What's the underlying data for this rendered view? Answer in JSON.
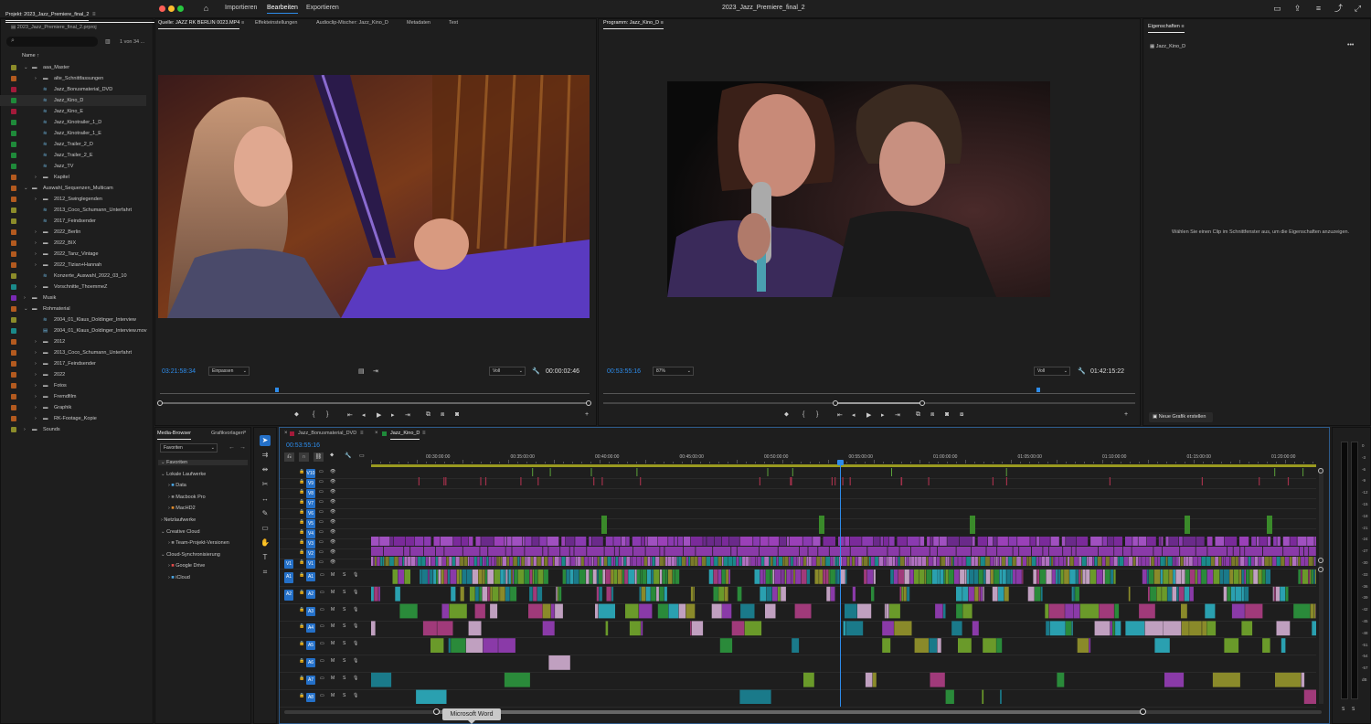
{
  "app": {
    "title": "2023_Jazz_Premiere_final_2",
    "nav": {
      "home": "home-icon",
      "import": "Importieren",
      "edit": "Bearbeiten",
      "export": "Exportieren"
    }
  },
  "project": {
    "tab": "Projekt: 2023_Jazz_Premiere_final_2",
    "file": "2023_Jazz_Premiere_final_2.prproj",
    "count": "1 von 34 ...",
    "column_name": "Name",
    "items": [
      {
        "label": "aaa_Master",
        "color": "#8c8c2a",
        "indent": 0,
        "type": "folder",
        "open": true
      },
      {
        "label": "alte_Schnittfassungen",
        "color": "#b35a1f",
        "indent": 1,
        "type": "folder"
      },
      {
        "label": "Jazz_Bonusmaterial_DVD",
        "color": "#a31a3a",
        "indent": 1,
        "type": "seq"
      },
      {
        "label": "Jazz_Kino_D",
        "color": "#1f8a3a",
        "indent": 1,
        "type": "seq",
        "selected": true
      },
      {
        "label": "Jazz_Kino_E",
        "color": "#a31a3a",
        "indent": 1,
        "type": "seq"
      },
      {
        "label": "Jazz_Kinotrailer_1_D",
        "color": "#1f8a3a",
        "indent": 1,
        "type": "seq"
      },
      {
        "label": "Jazz_Kinotrailer_1_E",
        "color": "#1f8a3a",
        "indent": 1,
        "type": "seq"
      },
      {
        "label": "Jazz_Trailer_2_D",
        "color": "#1f8a3a",
        "indent": 1,
        "type": "seq"
      },
      {
        "label": "Jazz_Trailer_2_E",
        "color": "#1f8a3a",
        "indent": 1,
        "type": "seq"
      },
      {
        "label": "Jazz_TV",
        "color": "#1f8a3a",
        "indent": 1,
        "type": "seq"
      },
      {
        "label": "Kapitel",
        "color": "#b35a1f",
        "indent": 1,
        "type": "folder"
      },
      {
        "label": "Auswahl_Sequenzen_Multicam",
        "color": "#b35a1f",
        "indent": 0,
        "type": "folder",
        "open": true
      },
      {
        "label": "2012_Swinglegenden",
        "color": "#b35a1f",
        "indent": 1,
        "type": "folder"
      },
      {
        "label": "2013_Coco_Schumann_Unterfahrt",
        "color": "#8c8c2a",
        "indent": 1,
        "type": "seq"
      },
      {
        "label": "2017_Feindsender",
        "color": "#8c8c2a",
        "indent": 1,
        "type": "seq"
      },
      {
        "label": "2022_Berlin",
        "color": "#b35a1f",
        "indent": 1,
        "type": "folder"
      },
      {
        "label": "2022_BIX",
        "color": "#b35a1f",
        "indent": 1,
        "type": "folder"
      },
      {
        "label": "2022_Tanz_Vintage",
        "color": "#b35a1f",
        "indent": 1,
        "type": "folder"
      },
      {
        "label": "2022_Tizian+Hannah",
        "color": "#b35a1f",
        "indent": 1,
        "type": "folder"
      },
      {
        "label": "Konzerte_Auswahl_2022_03_10",
        "color": "#8c8c2a",
        "indent": 1,
        "type": "seq"
      },
      {
        "label": "Vorschnitte_ThoemmeZ",
        "color": "#1a8a8a",
        "indent": 1,
        "type": "folder"
      },
      {
        "label": "Musik",
        "color": "#7a2ab3",
        "indent": 0,
        "type": "folder"
      },
      {
        "label": "Rohmaterial",
        "color": "#b35a1f",
        "indent": 0,
        "type": "folder",
        "open": true
      },
      {
        "label": "2004_01_Klaus_Doldinger_Interview",
        "color": "#8c8c2a",
        "indent": 1,
        "type": "seq"
      },
      {
        "label": "2004_01_Klaus_Doldinger_Interview.mov",
        "color": "#1a8a8a",
        "indent": 1,
        "type": "clip"
      },
      {
        "label": "2012",
        "color": "#b35a1f",
        "indent": 1,
        "type": "folder"
      },
      {
        "label": "2013_Coco_Schumann_Unterfahrt",
        "color": "#b35a1f",
        "indent": 1,
        "type": "folder"
      },
      {
        "label": "2017_Feindsender",
        "color": "#b35a1f",
        "indent": 1,
        "type": "folder"
      },
      {
        "label": "2022",
        "color": "#b35a1f",
        "indent": 1,
        "type": "folder"
      },
      {
        "label": "Fotos",
        "color": "#b35a1f",
        "indent": 1,
        "type": "folder"
      },
      {
        "label": "Fremdfilm",
        "color": "#b35a1f",
        "indent": 1,
        "type": "folder"
      },
      {
        "label": "Graphik",
        "color": "#b35a1f",
        "indent": 1,
        "type": "folder"
      },
      {
        "label": "RK-Footage_Kopie",
        "color": "#b35a1f",
        "indent": 1,
        "type": "folder"
      },
      {
        "label": "Sounds",
        "color": "#8c8c2a",
        "indent": 0,
        "type": "folder"
      }
    ]
  },
  "source": {
    "tabs": [
      "Quelle: JAZZ RK BERLIN 0023.MP4",
      "Effekteinstellungen",
      "Audioclip-Mischer: Jazz_Kino_D",
      "Metadaten",
      "Text"
    ],
    "timecode": "03:21:58:34",
    "fit": "Einpassen",
    "quality": "Voll",
    "duration": "00:00:02:46"
  },
  "program": {
    "tab": "Programm: Jazz_Kino_D",
    "timecode": "00:53:55:16",
    "zoom": "87%",
    "quality": "Voll",
    "duration": "01:42:15:22"
  },
  "properties": {
    "tab": "Eigenschaften",
    "seq": "Jazz_Kino_D",
    "hint": "Wählen Sie einen Clip im Schnittfenster aus, um die Eigenschaften anzuzeigen.",
    "new_graphic": "Neue Grafik erstellen"
  },
  "media_browser": {
    "tabs": [
      "Media-Browser",
      "Grafikvorlagen"
    ],
    "dropdown": "Favoriten",
    "items": [
      {
        "label": "Favoriten",
        "indent": 0,
        "kind": "header",
        "open": true
      },
      {
        "label": "Lokale Laufwerke",
        "indent": 0,
        "kind": "header",
        "open": true
      },
      {
        "label": "Data",
        "indent": 1,
        "kind": "drive",
        "color": "#4aa3e0"
      },
      {
        "label": "Macbook Pro",
        "indent": 1,
        "kind": "drive",
        "color": "#888888"
      },
      {
        "label": "MacHD2",
        "indent": 1,
        "kind": "drive",
        "color": "#e08a2a"
      },
      {
        "label": "Netzlaufwerke",
        "indent": 0,
        "kind": "header",
        "open": false
      },
      {
        "label": "Creative Cloud",
        "indent": 0,
        "kind": "header",
        "open": true
      },
      {
        "label": "Team-Projekt-Versionen",
        "indent": 1,
        "kind": "drive",
        "color": "#888888"
      },
      {
        "label": "Cloud-Synchronisierung",
        "indent": 0,
        "kind": "header",
        "open": true
      },
      {
        "label": "Google Drive",
        "indent": 1,
        "kind": "drive",
        "color": "#e04a4a"
      },
      {
        "label": "iCloud",
        "indent": 1,
        "kind": "drive",
        "color": "#4aa3e0"
      }
    ]
  },
  "timeline": {
    "tabs": [
      {
        "label": "Jazz_Bonusmaterial_DVD",
        "color": "#a31a3a"
      },
      {
        "label": "Jazz_Kino_D",
        "color": "#1f8a3a"
      }
    ],
    "timecode": "00:53:55:16",
    "ruler": [
      "00:30:00:00",
      "00:35:00:00",
      "00:40:00:00",
      "00:45:00:00",
      "00:50:00:00",
      "00:55:00:00",
      "01:00:00:00",
      "01:05:00:00",
      "01:10:00:00",
      "01:15:00:00",
      "01:20:00:00"
    ],
    "video_tracks": [
      "V10",
      "V9",
      "V8",
      "V7",
      "V6",
      "V5",
      "V4",
      "V3",
      "V2",
      "V1"
    ],
    "audio_tracks": [
      "A1",
      "A2",
      "A3",
      "A4",
      "A5",
      "A6",
      "A7",
      "A8"
    ],
    "playhead_fraction": 0.496
  },
  "meter": {
    "labels": [
      "0",
      "-3",
      "-6",
      "-9",
      "-12",
      "-15",
      "-18",
      "-21",
      "-24",
      "-27",
      "-30",
      "-33",
      "-36",
      "-39",
      "-42",
      "-45",
      "-48",
      "-51",
      "-54",
      "-57",
      "dB"
    ],
    "solo": [
      "S",
      "S"
    ]
  },
  "tooltip": "Microsoft Word"
}
